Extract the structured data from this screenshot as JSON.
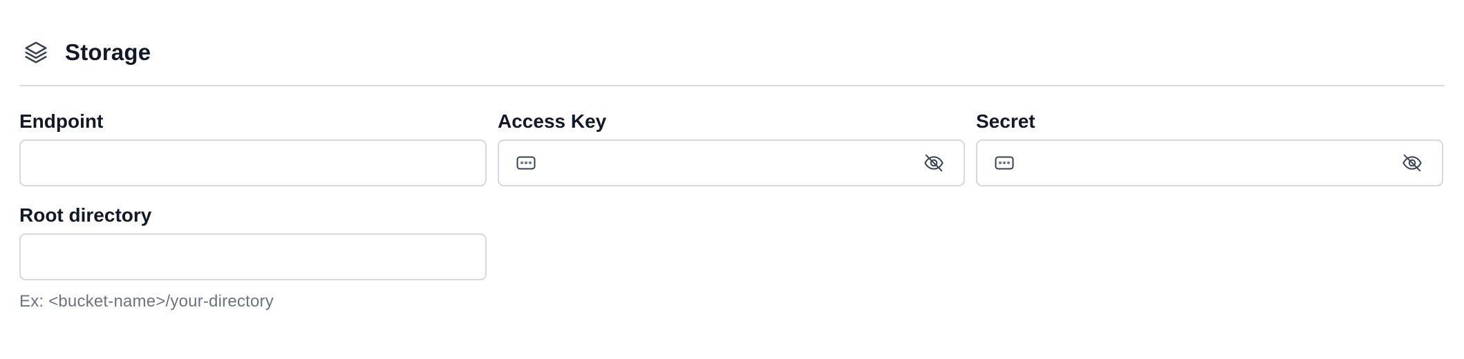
{
  "section": {
    "title": "Storage",
    "icon": "layers-icon"
  },
  "fields": {
    "endpoint": {
      "label": "Endpoint",
      "value": "",
      "placeholder": ""
    },
    "access_key": {
      "label": "Access Key",
      "value": "",
      "placeholder": "",
      "lead_icon": "password-dots-icon",
      "trail_icon": "eye-off-icon"
    },
    "secret": {
      "label": "Secret",
      "value": "",
      "placeholder": "",
      "lead_icon": "password-dots-icon",
      "trail_icon": "eye-off-icon"
    },
    "root_directory": {
      "label": "Root directory",
      "value": "",
      "placeholder": "",
      "helper": "Ex: <bucket-name>/your-directory"
    }
  },
  "colors": {
    "text": "#111827",
    "muted": "#6b7280",
    "border": "#d6d8dd",
    "divider": "#d9dbe0"
  }
}
